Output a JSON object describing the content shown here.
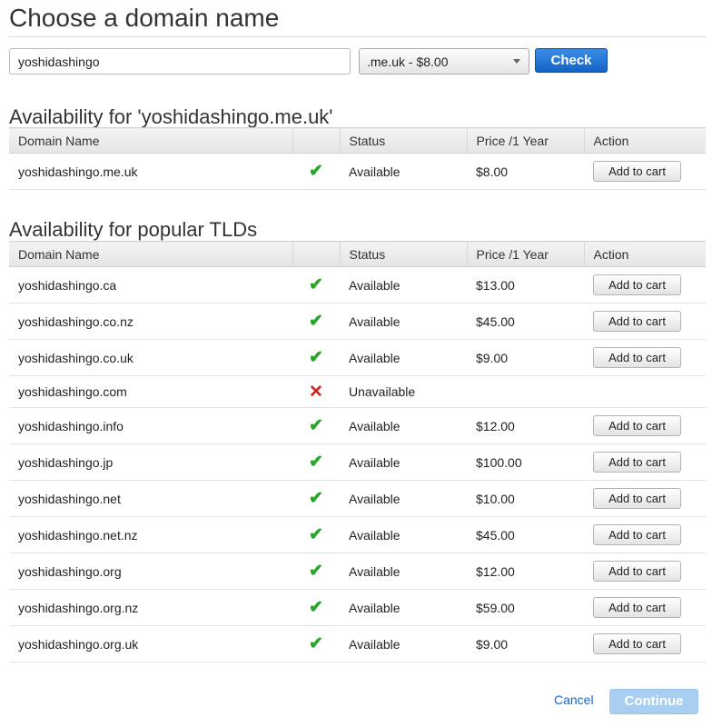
{
  "page_title": "Choose a domain name",
  "search": {
    "value": "yoshidashingo"
  },
  "tld_select": {
    "selected": ".me.uk - $8.00"
  },
  "check_button": "Check",
  "columns": {
    "domain": "Domain Name",
    "status": "Status",
    "price": "Price /1 Year",
    "action": "Action"
  },
  "availability": {
    "title": "Availability for 'yoshidashingo.me.uk'",
    "rows": [
      {
        "domain": "yoshidashingo.me.uk",
        "available": true,
        "status": "Available",
        "price": "$8.00",
        "action": "Add to cart"
      }
    ]
  },
  "popular": {
    "title": "Availability for popular TLDs",
    "rows": [
      {
        "domain": "yoshidashingo.ca",
        "available": true,
        "status": "Available",
        "price": "$13.00",
        "action": "Add to cart"
      },
      {
        "domain": "yoshidashingo.co.nz",
        "available": true,
        "status": "Available",
        "price": "$45.00",
        "action": "Add to cart"
      },
      {
        "domain": "yoshidashingo.co.uk",
        "available": true,
        "status": "Available",
        "price": "$9.00",
        "action": "Add to cart"
      },
      {
        "domain": "yoshidashingo.com",
        "available": false,
        "status": "Unavailable",
        "price": "",
        "action": ""
      },
      {
        "domain": "yoshidashingo.info",
        "available": true,
        "status": "Available",
        "price": "$12.00",
        "action": "Add to cart"
      },
      {
        "domain": "yoshidashingo.jp",
        "available": true,
        "status": "Available",
        "price": "$100.00",
        "action": "Add to cart"
      },
      {
        "domain": "yoshidashingo.net",
        "available": true,
        "status": "Available",
        "price": "$10.00",
        "action": "Add to cart"
      },
      {
        "domain": "yoshidashingo.net.nz",
        "available": true,
        "status": "Available",
        "price": "$45.00",
        "action": "Add to cart"
      },
      {
        "domain": "yoshidashingo.org",
        "available": true,
        "status": "Available",
        "price": "$12.00",
        "action": "Add to cart"
      },
      {
        "domain": "yoshidashingo.org.nz",
        "available": true,
        "status": "Available",
        "price": "$59.00",
        "action": "Add to cart"
      },
      {
        "domain": "yoshidashingo.org.uk",
        "available": true,
        "status": "Available",
        "price": "$9.00",
        "action": "Add to cart"
      }
    ]
  },
  "footer": {
    "cancel": "Cancel",
    "continue": "Continue"
  },
  "colors": {
    "available": "#2aa52a",
    "unavailable": "#d11f1f",
    "primary": "#1462c7",
    "link": "#1668c7"
  },
  "icons": {
    "available": "check-icon",
    "unavailable": "cross-icon"
  }
}
